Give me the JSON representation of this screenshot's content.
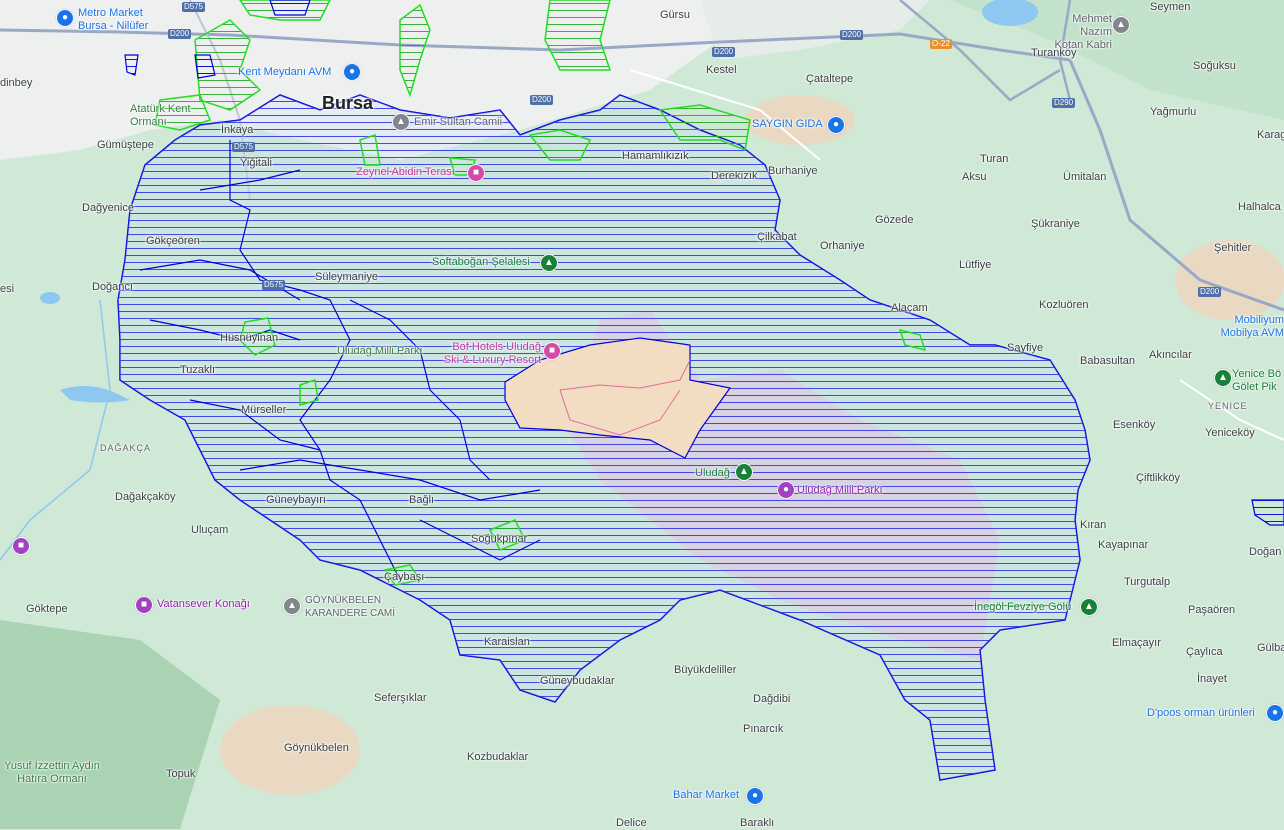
{
  "colors": {
    "hatch": "#0000dd",
    "overlay_fill": "rgba(200,220,255,0.25)",
    "green_outline": "#22dd22",
    "resort": "#f2dcc2",
    "park_pink": "rgba(240,180,220,0.45)"
  },
  "places": {
    "bursa": "Bursa",
    "gursu": "Gürsu",
    "kestel": "Kestel",
    "seymen": "Seymen",
    "soguksu": "Soğuksu",
    "turankoy": "Turanköy",
    "yagmurlu": "Yağmurlu",
    "karag": "Karag",
    "catalepe": "Çataltepe",
    "burhaniye": "Burhaniye",
    "turan": "Turan",
    "aksu": "Aksu",
    "umitalan": "Ümitalan",
    "halhalca": "Halhalca",
    "gozede": "Gözede",
    "sukraniye": "Şükraniye",
    "sehitler": "Şehitler",
    "orhaniye": "Orhaniye",
    "lutfiye": "Lütfiye",
    "kozluoren": "Kozluören",
    "alacam": "Alaçam",
    "sayfiye": "Sayfiye",
    "babasultan": "Babasultan",
    "akincilar": "Akıncılar",
    "esenkoy": "Esenköy",
    "yenicekoy": "Yeniceköy",
    "ciftlikkoy": "Çiftlikköy",
    "kiran": "Kıran",
    "kayapinar": "Kayapınar",
    "dogan": "Doğan",
    "turgutalp": "Turgutalp",
    "pasaoren": "Paşaören",
    "elmacayir": "Elmaçayır",
    "caylica": "Çaylıca",
    "gulba": "Gülba",
    "inayet": "İnayet",
    "buyukdeliller": "Büyükdeliller",
    "dagdibi": "Dağdibi",
    "pinarcik": "Pınarcık",
    "kozbudaklar": "Kozbudaklar",
    "delice": "Delice",
    "barakli": "Baraklı",
    "goynukbelen": "Göynükbelen",
    "topuk": "Topuk",
    "sefersiklar": "Seferşıklar",
    "goktepe": "Göktepe",
    "ulucam": "Uluçam",
    "dagakcakoy": "Dağakçaköy",
    "dagakca_region": "DAĞAKÇA",
    "murseller": "Mürseller",
    "tuzakli": "Tuzaklı",
    "husnuyinan": "Hüsnüyinan",
    "doganci": "Doğancı",
    "gokceoren": "Gökçeören",
    "dagyenice": "Dağyenice",
    "gumustepe": "Gümüştepe",
    "dinbey": "dinbey",
    "inkaya": "İnkaya",
    "yigitali": "Yiğitali",
    "suleymaniye": "Süleymaniye",
    "guneybayiri": "Güneybayırı",
    "bagli": "Bağlı",
    "sogukpinar": "Soğukpınar",
    "caybasi": "Çaybaşı",
    "karaislan": "Karaislan",
    "guneybudaklar": "Güneybudaklar",
    "hamamlikizik": "Hamamlıkızık",
    "derekizik": "Derekızık",
    "cilkabat": "Çilkabat",
    "esi": "esi",
    "yenice_region": "YENICE"
  },
  "pois": {
    "metro_market": "Metro Market Bursa - Nilüfer",
    "kent_meydani": "Kent Meydanı AVM",
    "ataturk_kent": "Atatürk Kent Ormanı",
    "emir_sultan": "Emir Sultan Camii",
    "zeynel_abidin": "Zeynel Abidin Terası",
    "softabogan": "Softaboğan Şelalesi",
    "uludag_milli_parki_1": "Uludağ Milli Parkı",
    "bof_hotels": "Bof Hotels Uludağ Ski & Luxury Resort",
    "uludag": "Uludağ",
    "uludag_milli_parki_2": "Uludağ Milli Parkı",
    "saygin_gida": "SAYGIN GIDA",
    "mehmet_nazim": "Mehmet Nazım Kotan Kabri",
    "yenice_golet": "Yenice Bö Gölet Pik",
    "mobiliyum": "Mobiliyum Mobilya AVM",
    "inegol_fevziye": "İnegöl Fevziye Gölü",
    "dpoos": "D'poos orman ürünleri",
    "bahar_market": "Bahar Market",
    "vatansever": "Vatansever Konağı",
    "goynukbelen_cami": "GÖYNÜKBELEN KARANDERE CAMİ",
    "yusuf_izzettin": "Yusuf İzzettin Aydın Hatıra Ormanı"
  },
  "roads": {
    "d575_a": "D575",
    "d575_b": "D575",
    "d575_c": "D575",
    "d200_a": "D200",
    "d200_b": "D200",
    "d200_c": "D200",
    "d200_d": "D200",
    "d200_e": "D200",
    "o22": "O-22",
    "d290": "D290"
  },
  "icons": {
    "shopping": "shopping-bag-icon",
    "mosque": "mosque-icon",
    "hotel": "hotel-icon",
    "nature": "tree-icon",
    "landmark": "landmark-icon",
    "museum": "museum-icon"
  }
}
